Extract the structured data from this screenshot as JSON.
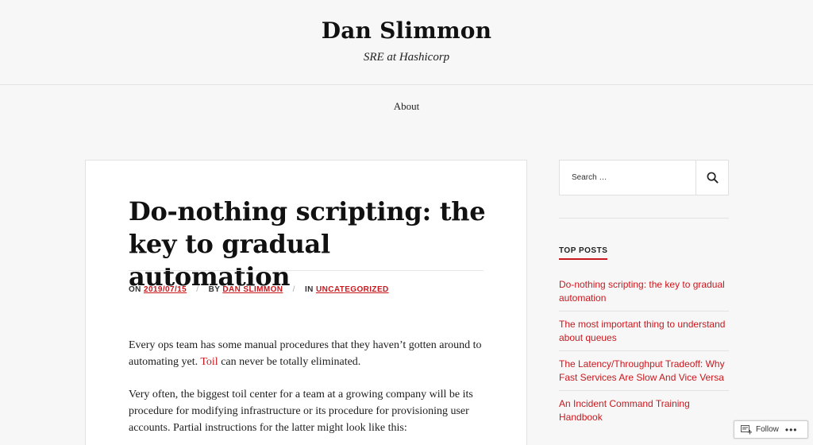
{
  "site": {
    "title": "Dan Slimmon",
    "description": "SRE at Hashicorp"
  },
  "nav": {
    "items": [
      {
        "label": "About"
      }
    ]
  },
  "post": {
    "title": "Do-nothing scripting: the key to gradual automation",
    "meta": {
      "on_label": "ON",
      "date": "2019/07/15",
      "by_label": "BY",
      "author": "DAN SLIMMON",
      "in_label": "IN",
      "category": "UNCATEGORIZED",
      "separator": "/"
    },
    "paragraphs": [
      {
        "before": "Every ops team has some manual procedures that they haven’t gotten around to automating yet.",
        "link": "Toil",
        "after": "can never be totally eliminated."
      },
      {
        "text": "Very often, the biggest toil center for a team at a growing company will be its procedure for modifying infrastructure or its procedure for provisioning user accounts. Partial instructions for the latter might look like this:"
      }
    ]
  },
  "sidebar": {
    "search": {
      "placeholder": "Search …",
      "icon": "search-icon"
    },
    "top_posts": {
      "title": "TOP POSTS",
      "items": [
        {
          "label": "Do-nothing scripting: the key to gradual automation"
        },
        {
          "label": "The most important thing to understand about queues"
        },
        {
          "label": "The Latency/Throughput Tradeoff: Why Fast Services Are Slow And Vice Versa"
        },
        {
          "label": "An Incident Command Training Handbook"
        }
      ]
    }
  },
  "follow_bar": {
    "label": "Follow",
    "more": "•••"
  },
  "colors": {
    "accent": "#c9181e",
    "background": "#f7f7f7"
  }
}
